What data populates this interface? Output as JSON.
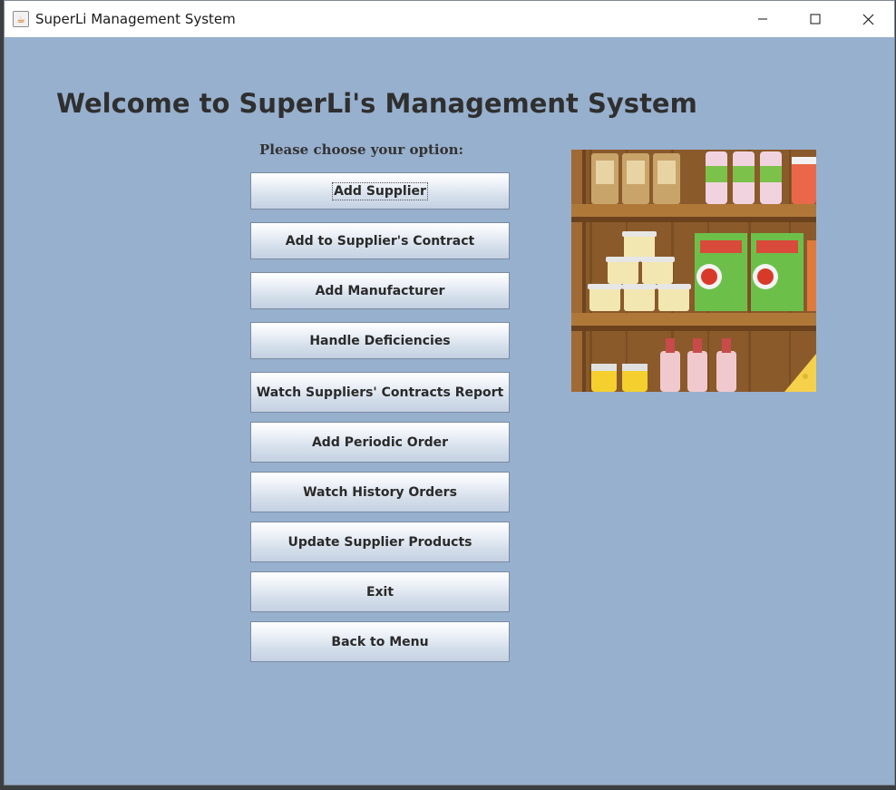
{
  "window": {
    "title": "SuperLi Management System",
    "app_icon": "java-cup-icon",
    "controls": [
      "minimize-icon",
      "maximize-icon",
      "close-icon"
    ]
  },
  "main": {
    "heading": "Welcome to SuperLi's Management System",
    "prompt": "Please choose your option:",
    "buttons": [
      {
        "label": "Add Supplier"
      },
      {
        "label": "Add to Supplier's Contract"
      },
      {
        "label": "Add Manufacturer"
      },
      {
        "label": "Handle Deficiencies"
      },
      {
        "label": "Watch Suppliers' Contracts Report"
      },
      {
        "label": "Add Periodic Order"
      },
      {
        "label": "Watch History Orders"
      },
      {
        "label": "Update Supplier Products"
      },
      {
        "label": "Exit"
      },
      {
        "label": "Back to Menu"
      }
    ],
    "illustration": "grocery-shelf-image"
  },
  "colors": {
    "background": "#97b0ce",
    "heading": "#2f2f2f",
    "button_top": "#ffffff",
    "button_bottom": "#c4d1e2"
  }
}
